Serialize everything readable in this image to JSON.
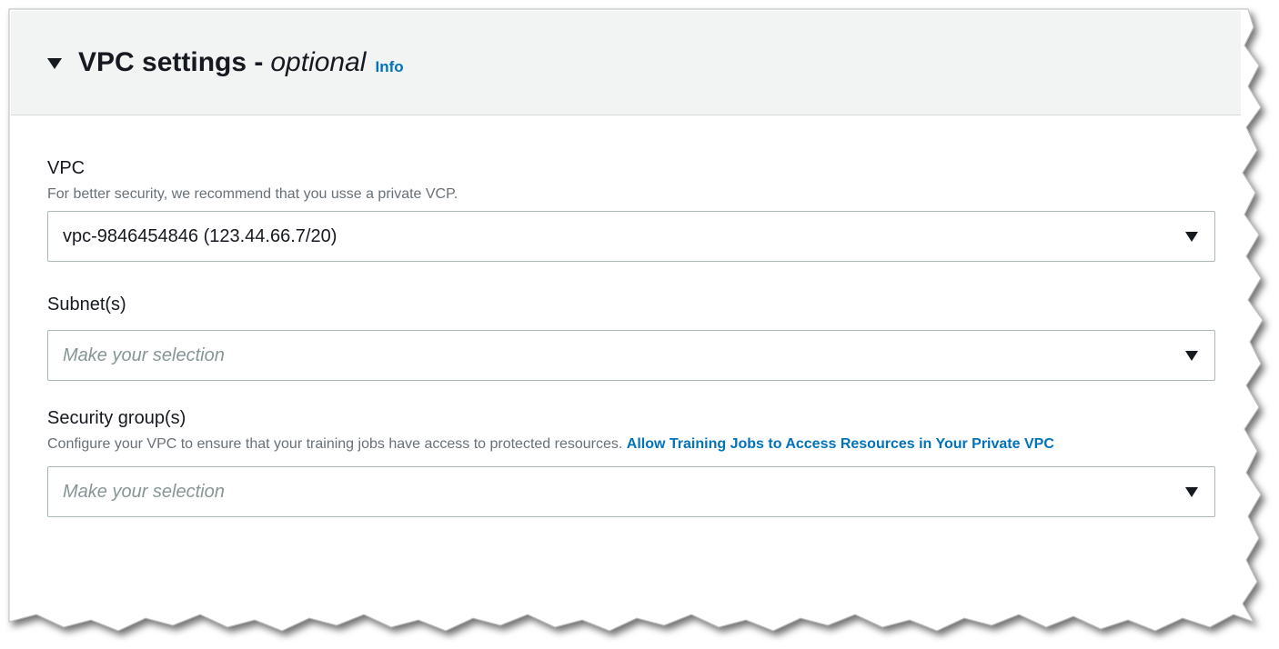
{
  "section": {
    "title": "VPC settings -",
    "title_suffix": "optional",
    "info_link": "Info",
    "caret_icon": "caret-down-icon"
  },
  "fields": {
    "vpc": {
      "label": "VPC",
      "description": "For better security, we recommend that you usse a private VCP.",
      "value": "vpc-9846454846 (123.44.66.7/20)"
    },
    "subnets": {
      "label": "Subnet(s)",
      "placeholder": "Make your selection"
    },
    "security_groups": {
      "label": "Security group(s)",
      "description": "Configure your VPC to ensure that your training jobs have access to protected resources.",
      "link_text": "Allow Training Jobs to Access Resources in Your Private VPC",
      "placeholder": "Make your selection"
    }
  },
  "colors": {
    "header_bg": "#f2f3f3",
    "link": "#0073bb",
    "placeholder": "#879596",
    "border": "#aab7b8"
  }
}
